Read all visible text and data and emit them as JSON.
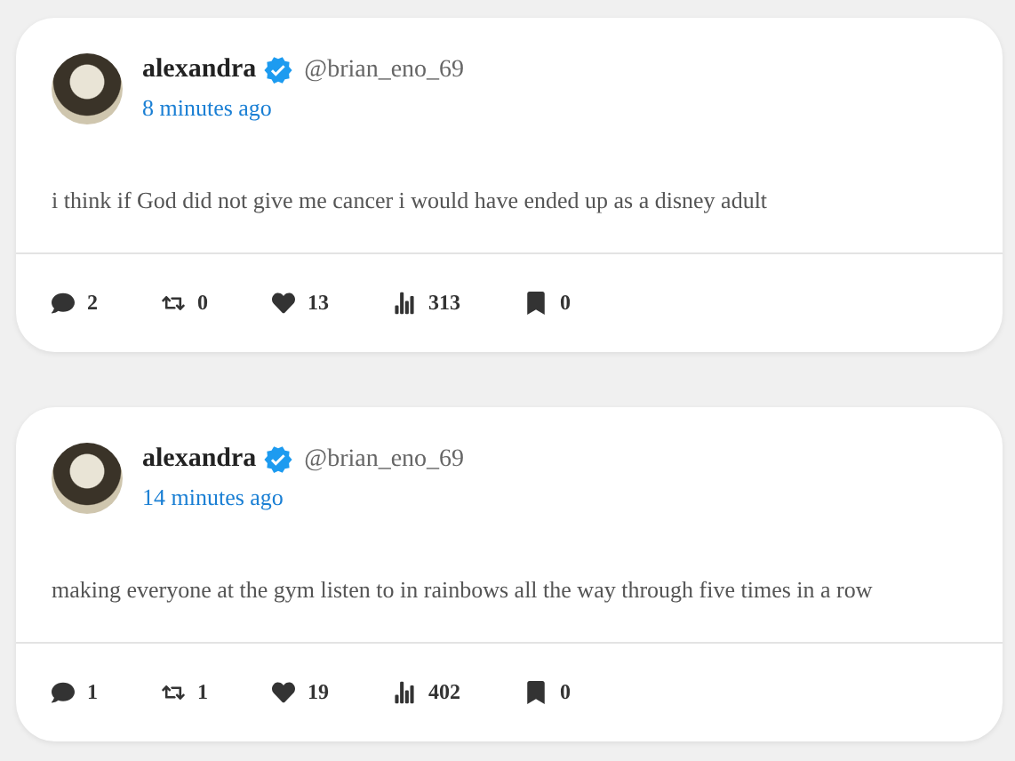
{
  "posts": [
    {
      "author": {
        "name": "alexandra",
        "verified": true,
        "handle": "@brian_eno_69"
      },
      "time": "8 minutes ago",
      "text": "i think if God did not give me cancer i would have ended up as a disney adult",
      "stats": [
        {
          "kind": "replies",
          "count": "2"
        },
        {
          "kind": "reposts",
          "count": "0"
        },
        {
          "kind": "likes",
          "count": "13"
        },
        {
          "kind": "views",
          "count": "313"
        },
        {
          "kind": "bookmarks",
          "count": "0"
        }
      ]
    },
    {
      "author": {
        "name": "alexandra",
        "verified": true,
        "handle": "@brian_eno_69"
      },
      "time": "14 minutes ago",
      "text": "making everyone at the gym listen to in rainbows all the way through five times in a row",
      "stats": [
        {
          "kind": "replies",
          "count": "1"
        },
        {
          "kind": "reposts",
          "count": "1"
        },
        {
          "kind": "likes",
          "count": "19"
        },
        {
          "kind": "views",
          "count": "402"
        },
        {
          "kind": "bookmarks",
          "count": "0"
        }
      ]
    }
  ]
}
